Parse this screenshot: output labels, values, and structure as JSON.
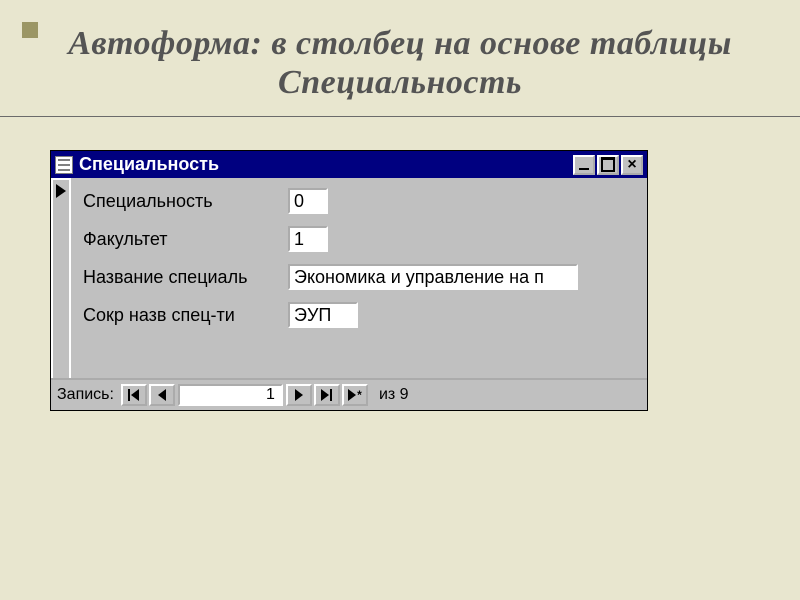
{
  "slide": {
    "title": "Автоформа: в столбец на основе таблицы Специальность"
  },
  "window": {
    "title": "Специальность",
    "form": {
      "field1_label": "Специальность",
      "field1_value": "0",
      "field2_label": "Факультет",
      "field2_value": "1",
      "field3_label": "Название специаль",
      "field3_value": "Экономика и управление на п",
      "field4_label": "Сокр назв спец-ти",
      "field4_value": "ЭУП"
    },
    "nav": {
      "label": "Запись:",
      "current": "1",
      "total_label": "из  9"
    }
  }
}
